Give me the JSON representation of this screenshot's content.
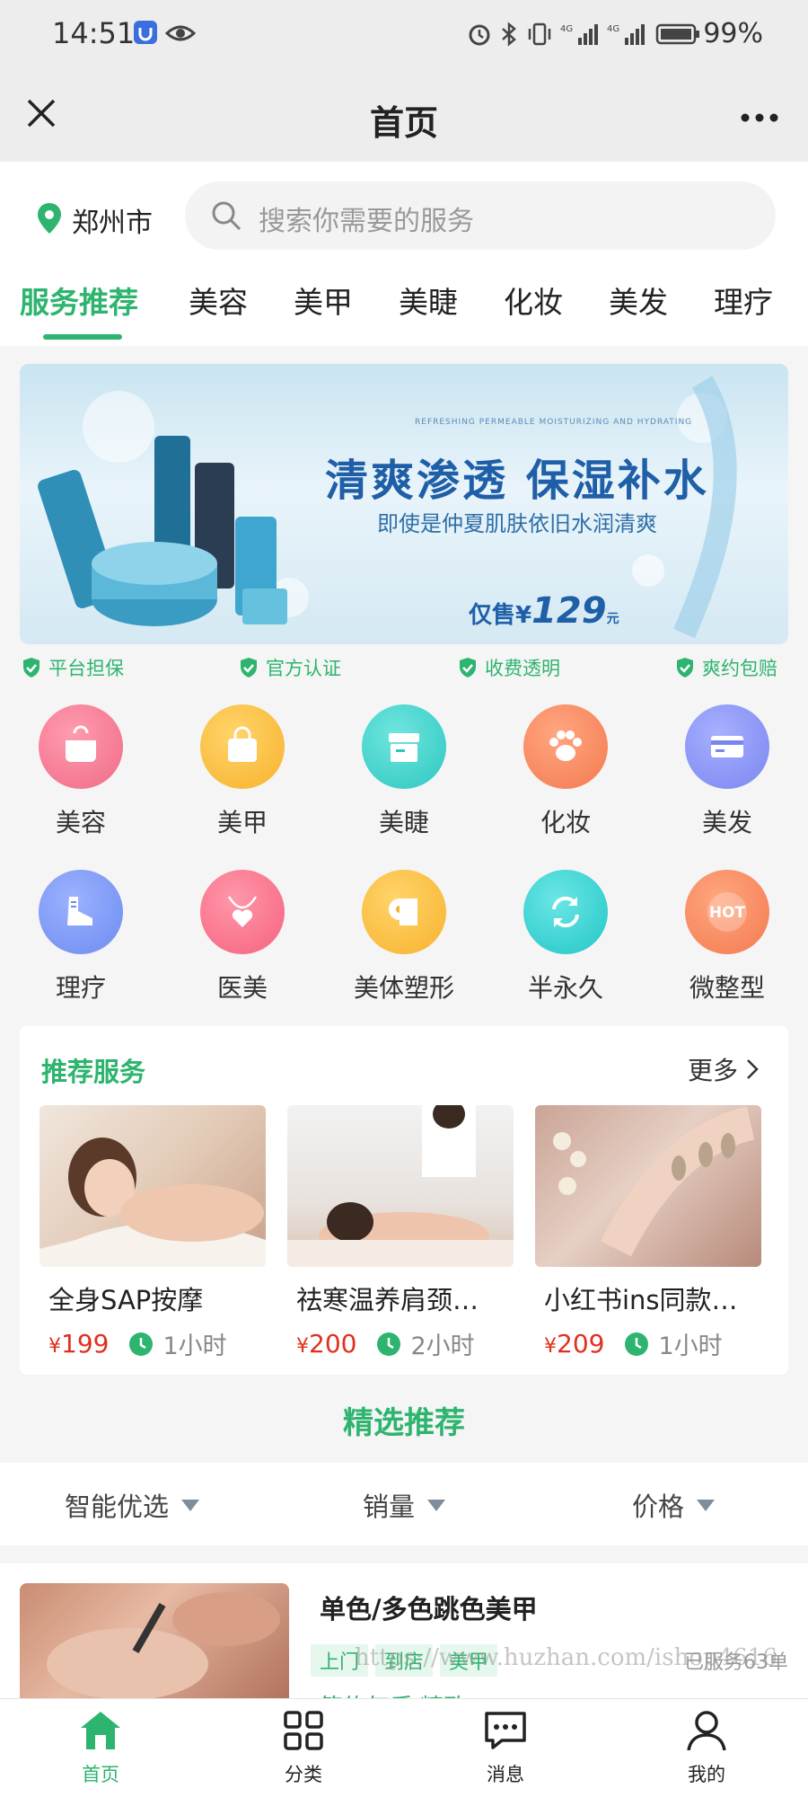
{
  "status_bar": {
    "time": "14:51",
    "battery": "99%"
  },
  "titlebar": {
    "title": "首页"
  },
  "location": {
    "city": "郑州市"
  },
  "search": {
    "placeholder": "搜索你需要的服务"
  },
  "tabs": [
    "服务推荐",
    "美容",
    "美甲",
    "美睫",
    "化妆",
    "美发",
    "理疗"
  ],
  "banner": {
    "headline": "清爽渗透 保湿补水",
    "subline": "即使是仲夏肌肤依旧水润清爽",
    "small_text": "REFRESHING PERMEABLE MOISTURIZING AND HYDRATING",
    "price_prefix": "仅售¥",
    "price": "129",
    "price_suffix": "元"
  },
  "guarantees": [
    "平台担保",
    "官方认证",
    "收费透明",
    "爽约包赔"
  ],
  "categories": [
    {
      "label": "美容",
      "icon": "pot-icon",
      "color": "#f06a86"
    },
    {
      "label": "美甲",
      "icon": "handbag-icon",
      "color": "#f7b22d"
    },
    {
      "label": "美睫",
      "icon": "box-icon",
      "color": "#2dc8c0"
    },
    {
      "label": "化妆",
      "icon": "paw-icon",
      "color": "#f47a4f"
    },
    {
      "label": "美发",
      "icon": "card-icon",
      "color": "#7a86f0"
    },
    {
      "label": "理疗",
      "icon": "shoe-icon",
      "color": "#6b8cf0"
    },
    {
      "label": "医美",
      "icon": "heart-necklace-icon",
      "color": "#f6627e"
    },
    {
      "label": "美体塑形",
      "icon": "toilet-paper-icon",
      "color": "#f7b22d"
    },
    {
      "label": "半永久",
      "icon": "refresh-icon",
      "color": "#22c6c6"
    },
    {
      "label": "微整型",
      "icon": "hot-badge-icon",
      "color": "#f47a4f",
      "badge_text": "HOT"
    }
  ],
  "recommended": {
    "title": "推荐服务",
    "more": "更多",
    "items": [
      {
        "name": "全身SAP按摩",
        "currency": "¥",
        "price": "199",
        "duration": "1小时"
      },
      {
        "name": "祛寒温养肩颈…",
        "currency": "¥",
        "price": "200",
        "duration": "2小时"
      },
      {
        "name": "小红书ins同款…",
        "currency": "¥",
        "price": "209",
        "duration": "1小时"
      }
    ]
  },
  "featured": {
    "title": "精选推荐"
  },
  "sort": [
    "智能优选",
    "销量",
    "价格"
  ],
  "listing": {
    "title": "单色/多色跳色美甲",
    "tags": [
      "上门",
      "到店",
      "美甲"
    ],
    "served": "已服务63单",
    "subtitle": "简约气质 精致..."
  },
  "watermark": "https://www.huzhan.com/ishop4616",
  "bottom_nav": [
    {
      "label": "首页",
      "icon": "home-icon",
      "active": true
    },
    {
      "label": "分类",
      "icon": "grid-icon",
      "active": false
    },
    {
      "label": "消息",
      "icon": "message-icon",
      "active": false
    },
    {
      "label": "我的",
      "icon": "user-icon",
      "active": false
    }
  ],
  "colors": {
    "accent": "#2db46e",
    "price": "#e0301e"
  }
}
